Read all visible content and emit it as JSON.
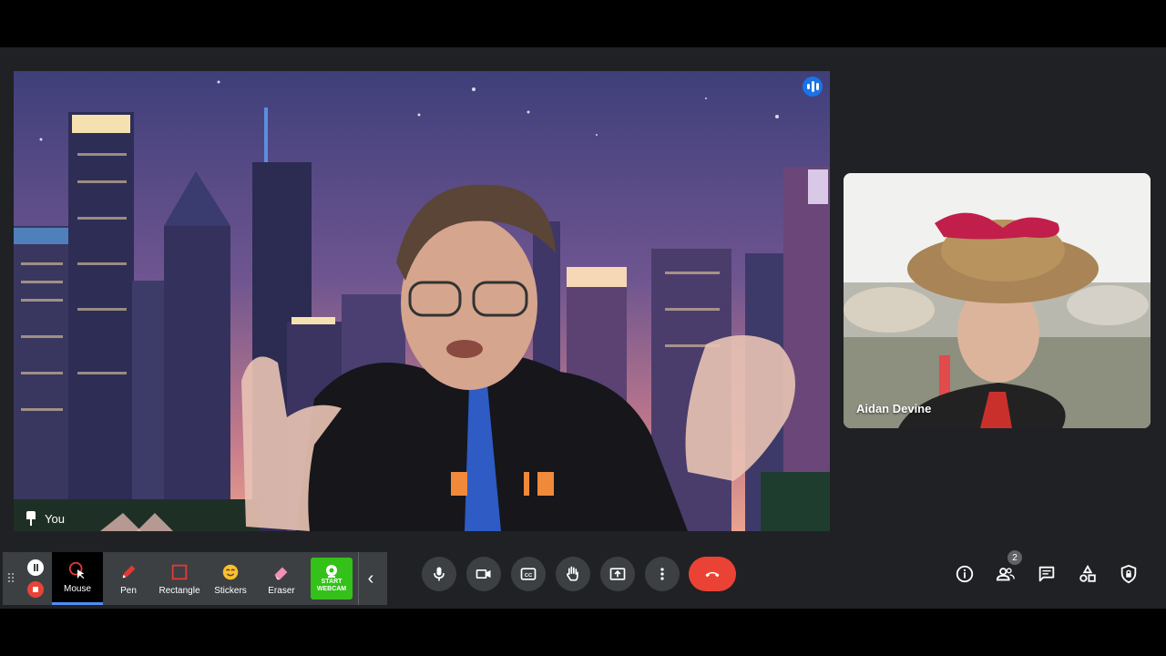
{
  "main_tile": {
    "self_label": "You"
  },
  "side_tile": {
    "participant_name": "Aidan Devine"
  },
  "annotation_toolbar": {
    "tools": [
      {
        "label": "Mouse",
        "icon": "mouse-cursor-icon",
        "active": true
      },
      {
        "label": "Pen",
        "icon": "pen-icon"
      },
      {
        "label": "Rectangle",
        "icon": "rectangle-icon"
      },
      {
        "label": "Stickers",
        "icon": "sticker-icon"
      },
      {
        "label": "Eraser",
        "icon": "eraser-icon"
      }
    ],
    "webcam_label_1": "START",
    "webcam_label_2": "WEBCAM"
  },
  "call_controls": [
    "microphone-icon",
    "camera-icon",
    "captions-icon",
    "raise-hand-icon",
    "present-icon",
    "more-options-icon",
    "hang-up-icon"
  ],
  "right_controls": {
    "participant_count": "2",
    "icons": [
      "info-icon",
      "people-icon",
      "chat-icon",
      "activities-icon",
      "host-controls-icon"
    ]
  },
  "colors": {
    "hangup": "#ea4335",
    "accent": "#1a73e8",
    "webcam": "#34c11a",
    "panel": "#3c4043"
  }
}
